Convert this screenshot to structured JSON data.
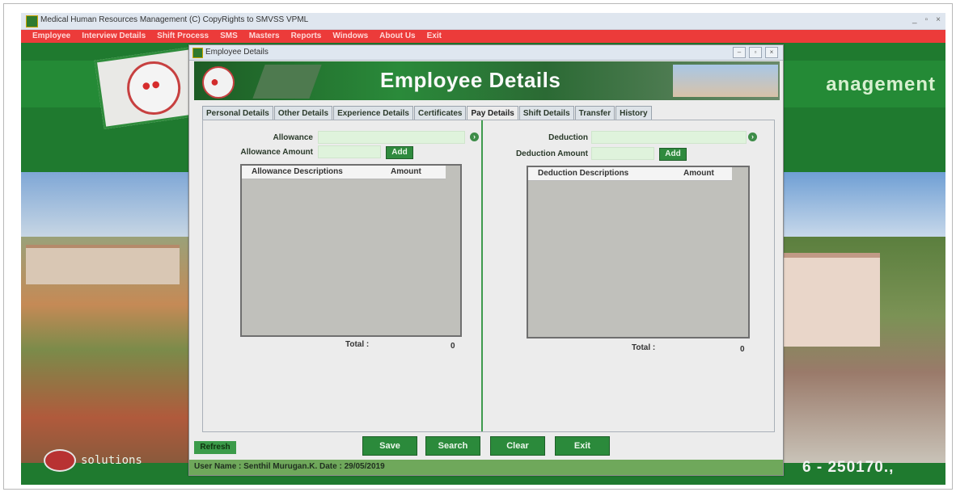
{
  "app": {
    "title": "Medical Human Resources Management  (C) CopyRights to SMVSS VPML",
    "window_controls": [
      "_",
      "▫",
      "×"
    ],
    "menu": [
      "Employee",
      "Interview Details",
      "Shift Process",
      "SMS",
      "Masters",
      "Reports",
      "Windows",
      "About Us",
      "Exit"
    ],
    "bg_title": "anagement",
    "footer_brand": "solutions",
    "footer_phone": "6 - 250170.,"
  },
  "dialog": {
    "title": "Employee Details",
    "banner_title": "Employee Details",
    "tabs": [
      "Personal Details",
      "Other Details",
      "Experience Details",
      "Certificates",
      "Pay Details",
      "Shift Details",
      "Transfer",
      "History"
    ],
    "active_tab": "Pay Details",
    "allowance": {
      "label": "Allowance",
      "amount_label": "Allowance Amount",
      "add_label": "Add",
      "columns": [
        "Allowance Descriptions",
        "Amount"
      ],
      "total_label": "Total :",
      "total_value": "0"
    },
    "deduction": {
      "label": "Deduction",
      "amount_label": "Deduction Amount",
      "add_label": "Add",
      "columns": [
        "Deduction  Descriptions",
        "Amount"
      ],
      "total_label": "Total :",
      "total_value": "0"
    },
    "buttons": {
      "refresh": "Refresh",
      "save": "Save",
      "search": "Search",
      "clear": "Clear",
      "exit": "Exit"
    },
    "status": "User Name :  Senthil Murugan.K.  Date :  29/05/2019"
  }
}
